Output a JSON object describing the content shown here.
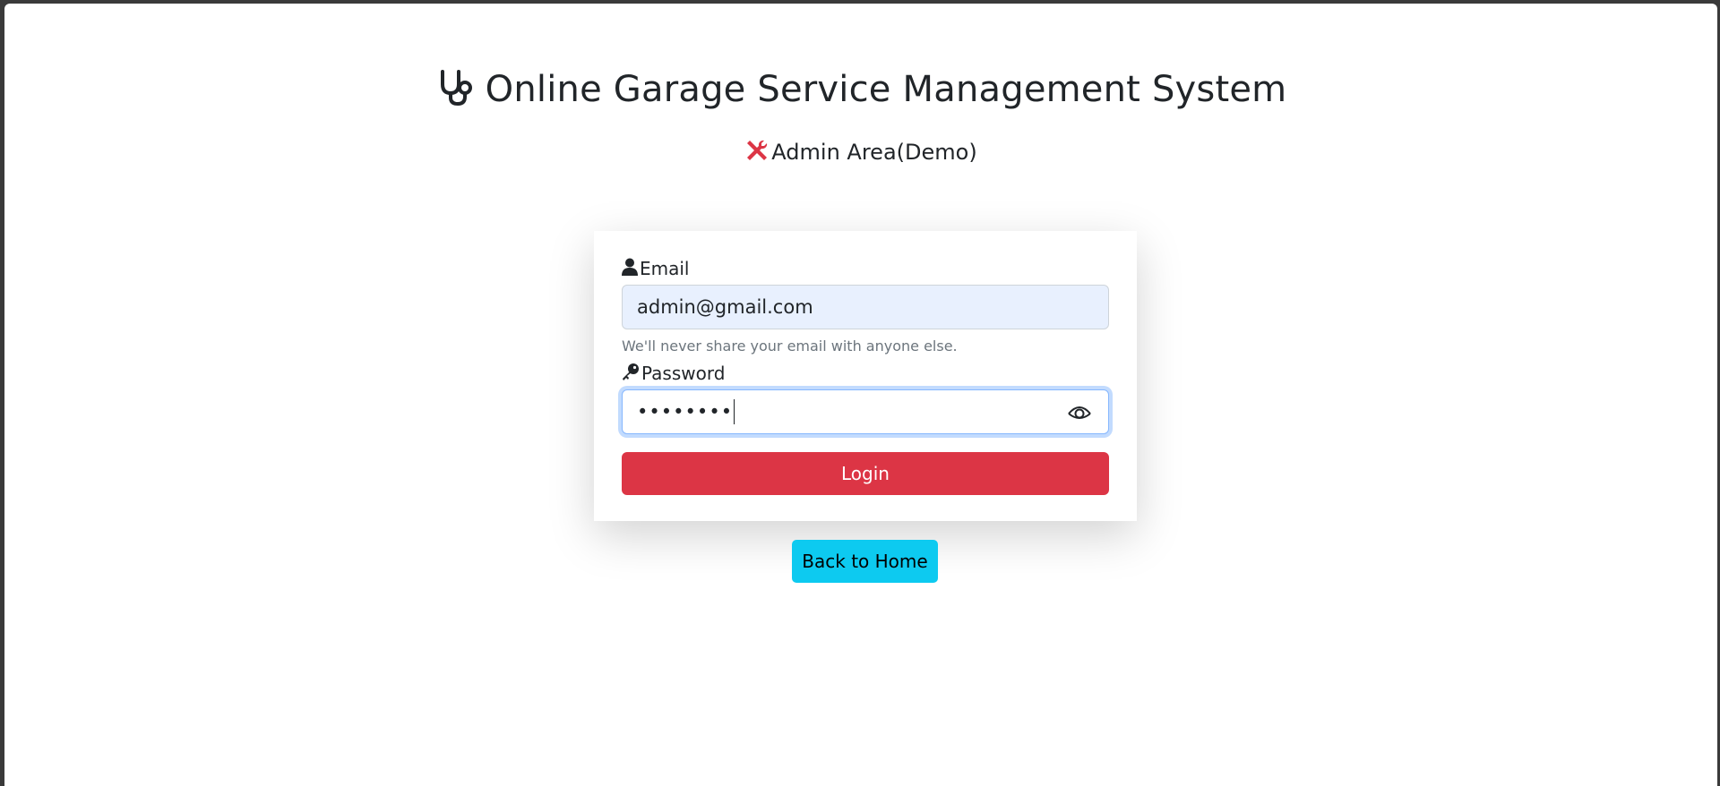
{
  "header": {
    "title": "Online Garage Service Management System",
    "title_icon": "stethoscope-icon",
    "subtitle": "Admin Area(Demo)",
    "subtitle_icon": "tools-icon"
  },
  "form": {
    "email": {
      "label": "Email",
      "icon": "user-icon",
      "value": "admin@gmail.com",
      "help": "We'll never share your email with anyone else."
    },
    "password": {
      "label": "Password",
      "icon": "key-icon",
      "value": "••••••••",
      "toggle_icon": "eye-icon"
    },
    "login_label": "Login"
  },
  "back_home_label": "Back to Home",
  "colors": {
    "login": "#dc3545",
    "back_home": "#0dcaf0",
    "email_bg": "#e8f0fe",
    "tools_icon": "#dc3545"
  }
}
